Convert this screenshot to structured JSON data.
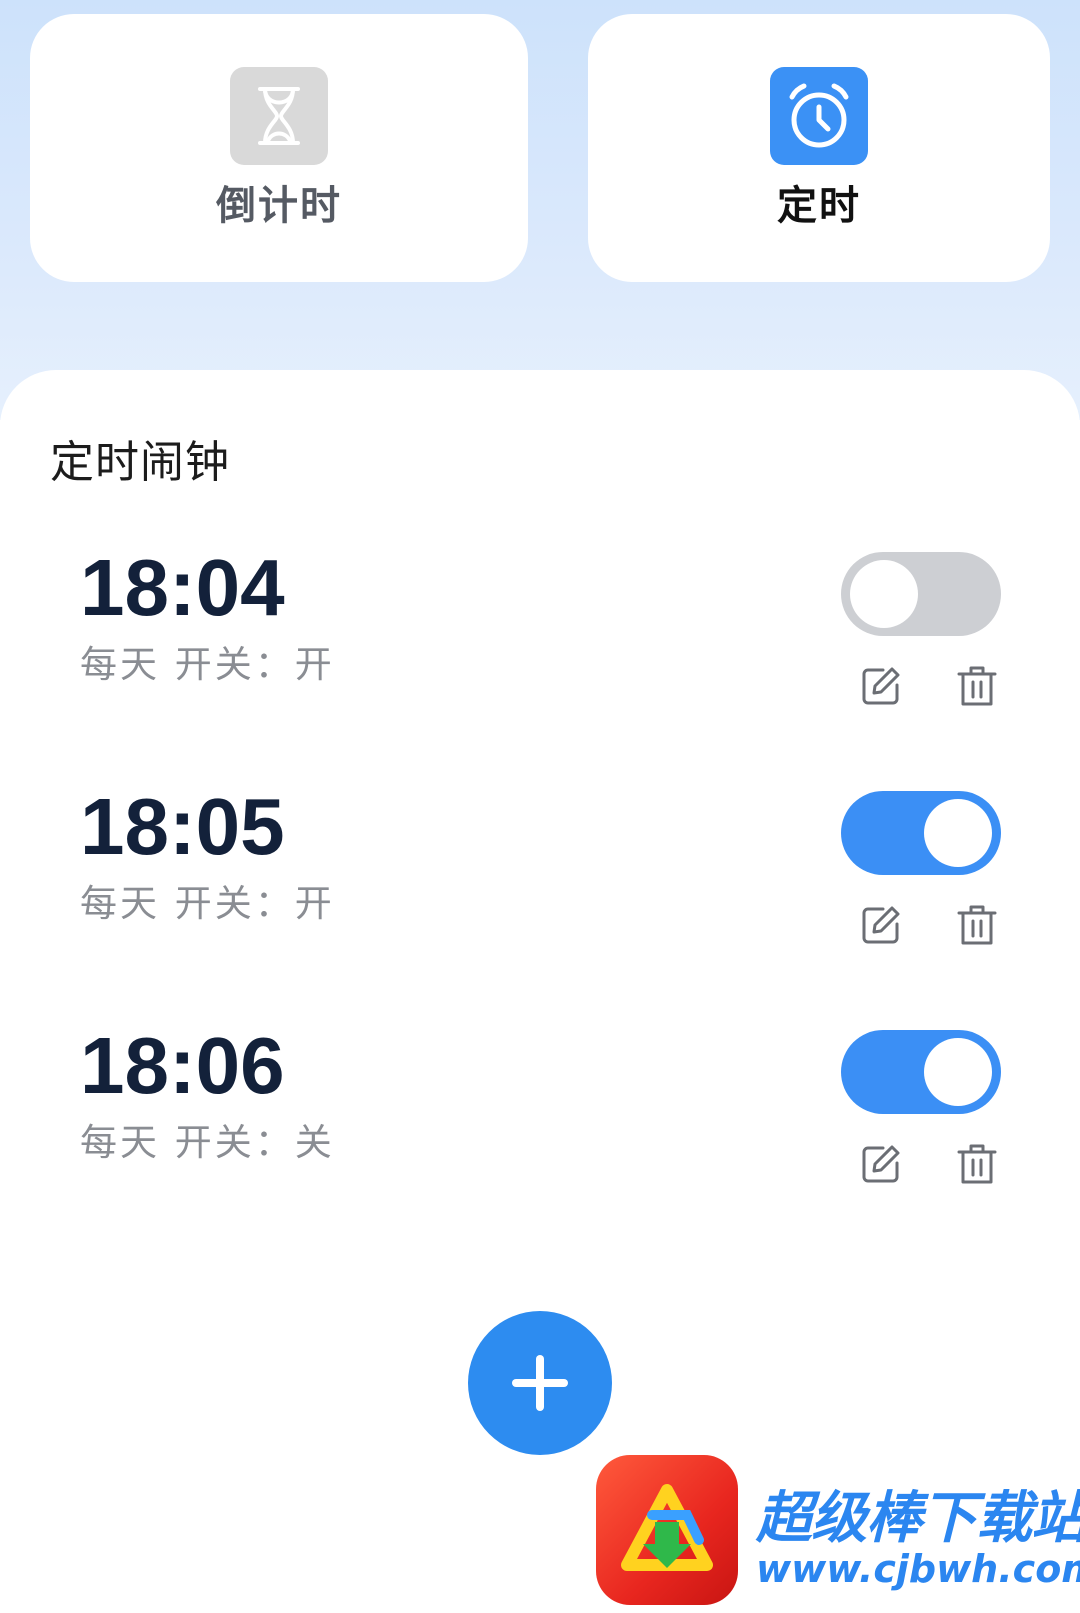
{
  "mode_tabs": [
    {
      "label": "倒计时",
      "icon": "hourglass-icon",
      "active": false
    },
    {
      "label": "定时",
      "icon": "alarm-clock-icon",
      "active": true
    }
  ],
  "section": {
    "title": "定时闹钟"
  },
  "alarms": [
    {
      "time": "18:04",
      "description": "每天 开关：开",
      "enabled": false
    },
    {
      "time": "18:05",
      "description": "每天 开关：开",
      "enabled": true
    },
    {
      "time": "18:06",
      "description": "每天 开关：关",
      "enabled": true
    }
  ],
  "row_actions": {
    "edit_icon": "edit-icon",
    "delete_icon": "trash-icon"
  },
  "add_button": {
    "icon": "plus-icon"
  },
  "watermark": {
    "title": "超级棒下载站",
    "url": "www.cjbwh.com"
  },
  "colors": {
    "accent": "#3b8ff5",
    "toggle_off": "#cdcfd3",
    "time_text": "#13213a",
    "muted_text": "#8a8d93"
  }
}
